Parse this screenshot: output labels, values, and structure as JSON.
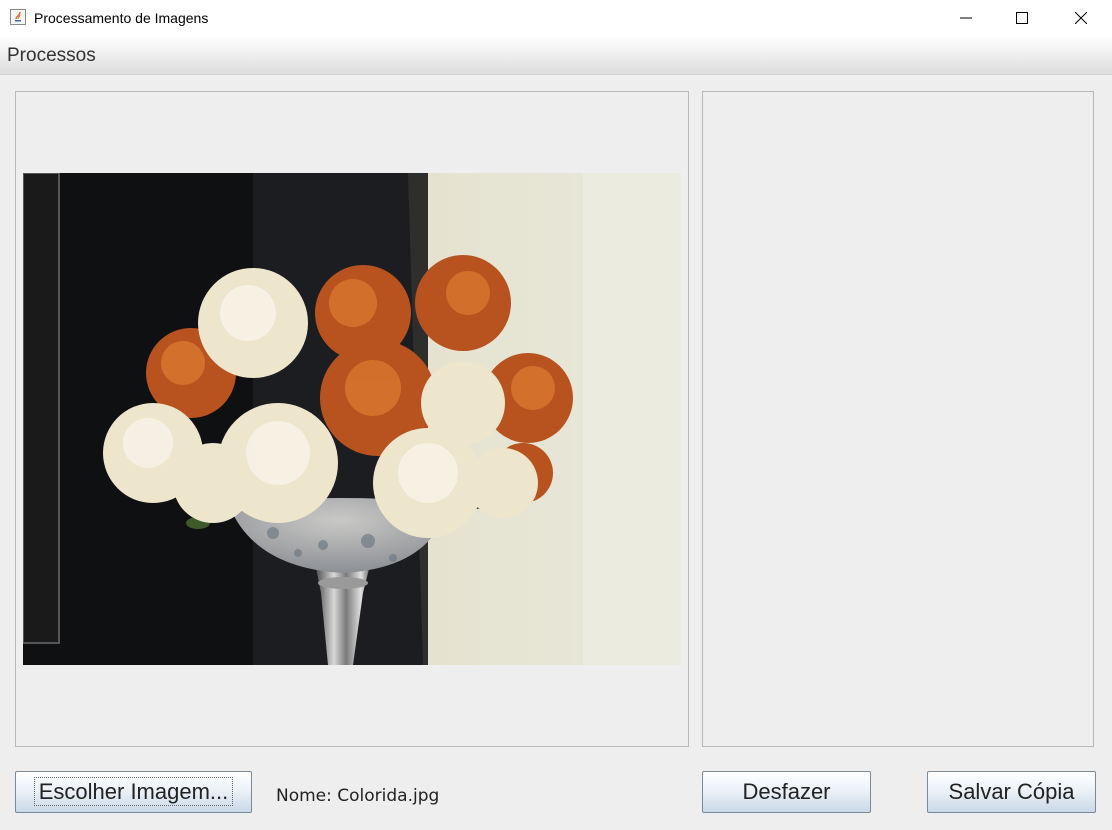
{
  "window": {
    "title": "Processamento de Imagens",
    "icons": [
      "java-icon",
      "minimize-icon",
      "maximize-icon",
      "close-icon"
    ]
  },
  "menu": {
    "items": [
      {
        "label": "Processos"
      }
    ]
  },
  "panels": {
    "original": {
      "image_description": "vase-of-flowers-photo"
    },
    "result": {
      "empty": true
    }
  },
  "footer": {
    "choose_button": "Escolher Imagem...",
    "name_label": "Nome: Colorida.jpg",
    "undo_button": "Desfazer",
    "save_button": "Salvar Cópia"
  },
  "colors": {
    "window_bg": "#eeeeee",
    "panel_border": "#b8b8b8",
    "button_gradient_bottom": "#c9d8e8"
  }
}
